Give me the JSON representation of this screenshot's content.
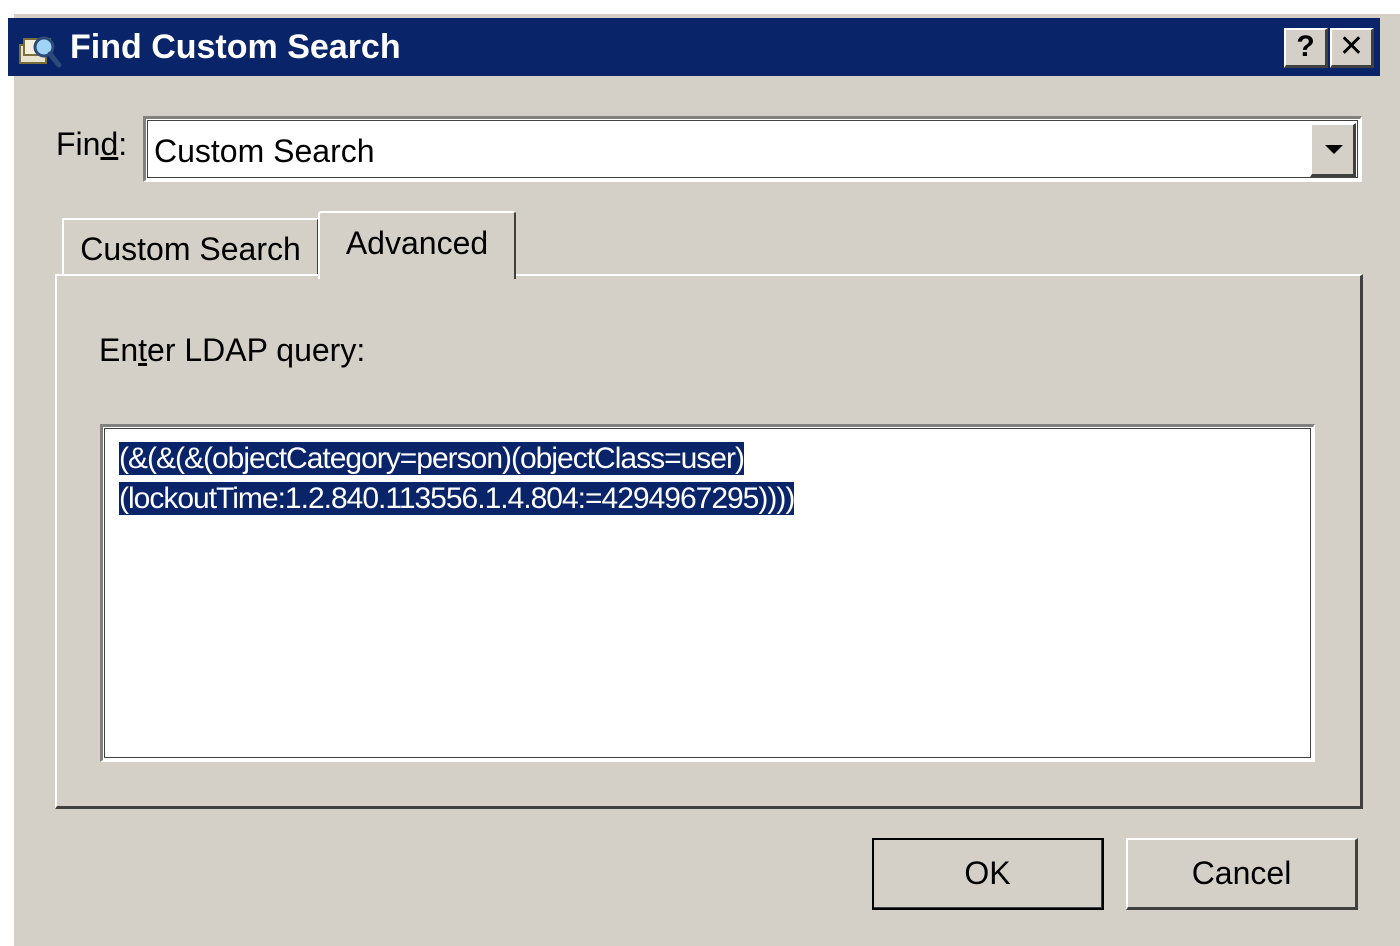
{
  "window": {
    "title": "Find Custom Search",
    "help_label": "?",
    "close_label": "✕"
  },
  "find": {
    "label_pre": "Fin",
    "label_accel": "d",
    "label_post": ":",
    "value": "Custom Search"
  },
  "tabs": [
    {
      "label": "Custom Search",
      "active": false
    },
    {
      "label": "Advanced",
      "active": true
    }
  ],
  "advanced": {
    "query_label_pre": "En",
    "query_label_accel": "t",
    "query_label_post": "er LDAP query:",
    "query_line1": "(&(&(&(objectCategory=person)(objectClass=user)",
    "query_line2": "(lockoutTime:1.2.840.113556.1.4.804:=4294967295))))"
  },
  "buttons": {
    "ok": "OK",
    "cancel": "Cancel"
  }
}
